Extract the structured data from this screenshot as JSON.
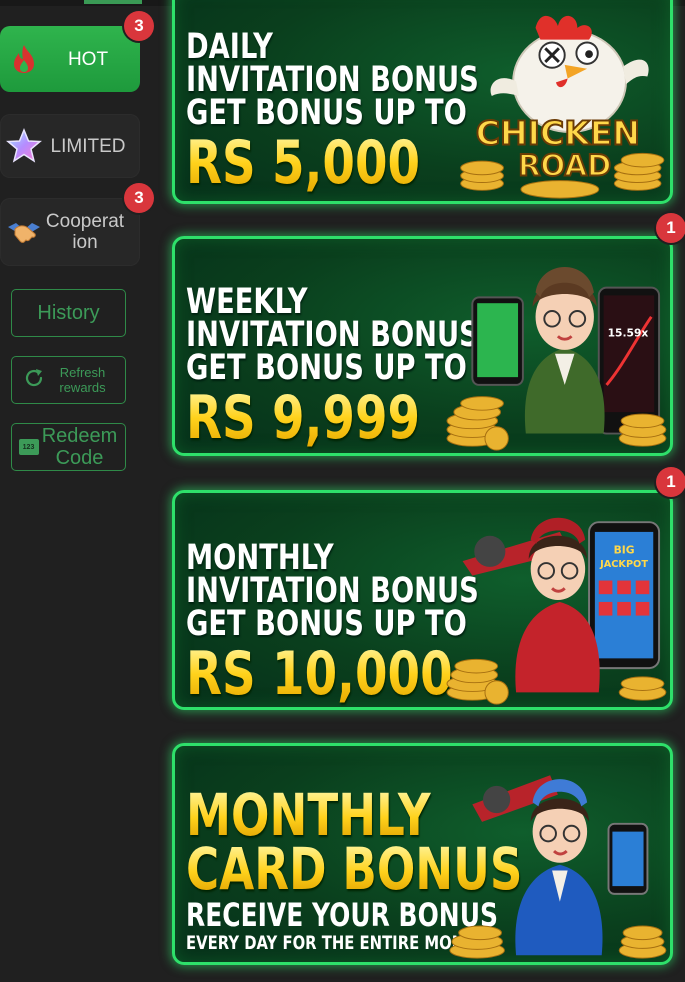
{
  "sidebar": {
    "categories": [
      {
        "label": "HOT",
        "icon": "flame-icon",
        "badge": "3",
        "active": true
      },
      {
        "label": "LIMITED",
        "icon": "star-icon",
        "badge": null,
        "active": false
      },
      {
        "label": "Cooperation",
        "icon": "handshake-icon",
        "badge": "3",
        "active": false
      }
    ],
    "actions": {
      "history": "History",
      "refresh": "Refresh rewards",
      "redeem": "Redeem Code",
      "redeem_icon_text": "123"
    }
  },
  "banners": [
    {
      "lines": [
        "DAILY",
        "INVITATION BONUS",
        "GET BONUS UP TO"
      ],
      "amount": "RS 5,000",
      "badge": null,
      "art": "chicken-road-illustration",
      "art_text": [
        "CHICKEN",
        "ROAD"
      ]
    },
    {
      "lines": [
        "WEEKLY",
        "INVITATION BONUS",
        "GET BONUS UP TO"
      ],
      "amount": "RS 9,999",
      "badge": "1",
      "art": "pilot-girl-illustration",
      "art_text": [
        "15.59x"
      ]
    },
    {
      "lines": [
        "MONTHLY",
        "INVITATION BONUS",
        "GET BONUS UP TO"
      ],
      "amount": "RS 10,000",
      "badge": "1",
      "art": "red-pilot-girl-illustration",
      "art_text": [
        "BIG",
        "JACKPOT"
      ]
    },
    {
      "title": [
        "MONTHLY",
        "CARD BONUS"
      ],
      "sub1": "RECEIVE YOUR BONUS",
      "sub2": "EVERY DAY FOR THE ENTIRE MONTH!",
      "badge": null,
      "art": "blue-pilot-girl-illustration"
    }
  ],
  "colors": {
    "accent_green": "#2fb44d",
    "banner_border": "#2ee06a",
    "badge_red": "#d9363c",
    "amount_gold": "#ffd21c",
    "background": "#202020"
  }
}
